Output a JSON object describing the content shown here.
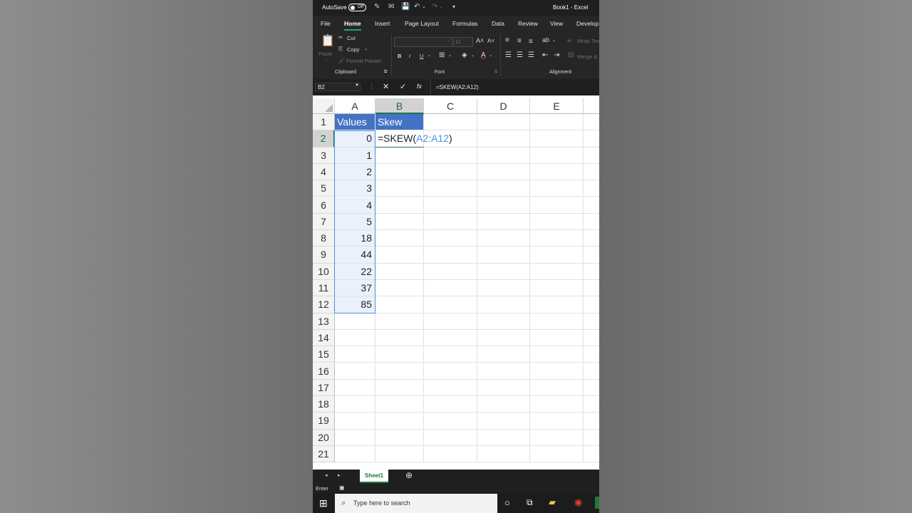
{
  "titlebar": {
    "autosave_label": "AutoSave",
    "autosave_state": "Off",
    "doc_title": "Book1  -  Excel"
  },
  "tabs": [
    "File",
    "Home",
    "Insert",
    "Page Layout",
    "Formulas",
    "Data",
    "Review",
    "View",
    "Develop"
  ],
  "ribbon": {
    "clipboard": {
      "paste": "Paste",
      "cut": "Cut",
      "copy": "Copy",
      "format_painter": "Format Painter",
      "label": "Clipboard"
    },
    "font": {
      "size": "11",
      "bold": "B",
      "italic": "I",
      "underline": "U",
      "label": "Font"
    },
    "alignment": {
      "wrap": "Wrap Text",
      "merge": "Merge &",
      "label": "Alignment"
    }
  },
  "formula_bar": {
    "name_box": "B2",
    "formula": "=SKEW(A2:A12)"
  },
  "columns": [
    "A",
    "B",
    "C",
    "D",
    "E"
  ],
  "rows": [
    "1",
    "2",
    "3",
    "4",
    "5",
    "6",
    "7",
    "8",
    "9",
    "10",
    "11",
    "12",
    "13",
    "14",
    "15",
    "16",
    "17",
    "18",
    "19",
    "20",
    "21"
  ],
  "cells": {
    "headers": {
      "a1": "Values",
      "b1": "Skew"
    },
    "values": [
      "0",
      "1",
      "2",
      "3",
      "4",
      "5",
      "18",
      "44",
      "22",
      "37",
      "85"
    ],
    "editing": {
      "prefix": "=SKEW(",
      "ref": "A2:A12",
      "suffix": ")"
    }
  },
  "sheet": {
    "tab": "Sheet1"
  },
  "status": {
    "mode": "Enter"
  },
  "taskbar": {
    "search_placeholder": "Type here to search"
  },
  "colors": {
    "header_fill": "#4472c4",
    "ref_color": "#4a90e2",
    "excel_green": "#217346"
  }
}
